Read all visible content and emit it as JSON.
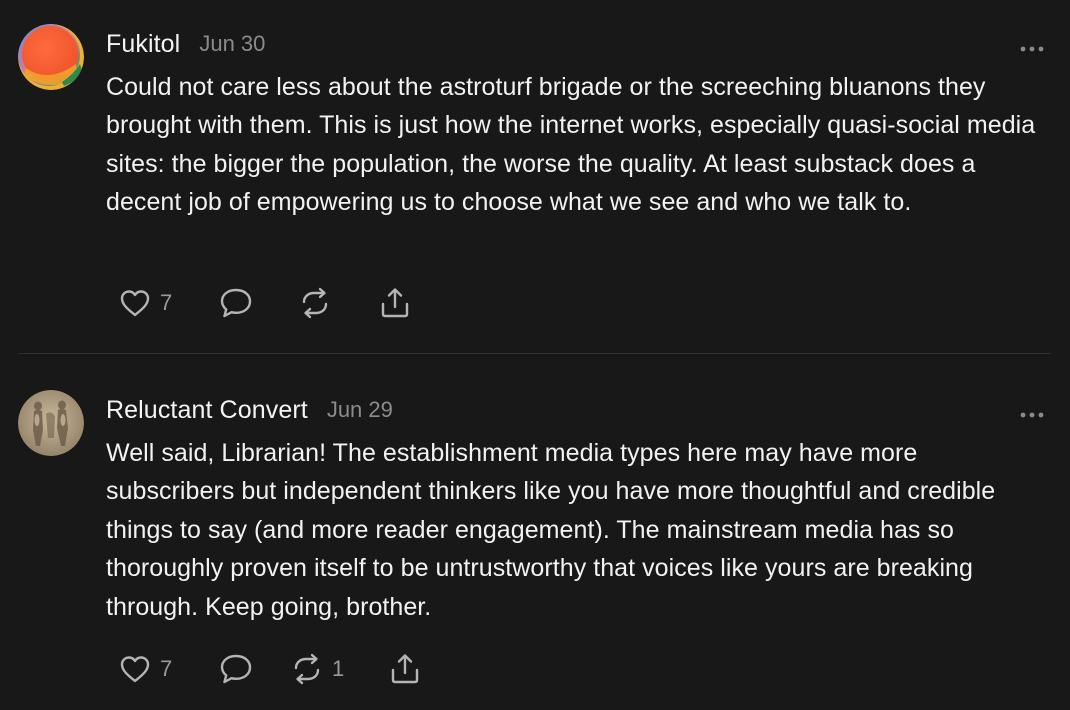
{
  "comments": [
    {
      "author": "Fukitol",
      "date": "Jun 30",
      "avatar_icon": "orange-gradient-avatar",
      "text": "Could not care less about the astroturf brigade or the screeching bluanons they brought with them. This is just how the internet works, especially quasi-social media sites: the bigger the population, the worse the quality. At least substack does a decent job of empowering us to choose what we see and who we talk to.",
      "likes": "7",
      "restacks": ""
    },
    {
      "author": "Reluctant Convert",
      "date": "Jun 29",
      "avatar_icon": "classical-relief-avatar",
      "text": "Well said, Librarian! The establishment media types here may have more subscribers but independent thinkers like you have more thoughtful and credible things to say (and more reader engagement). The mainstream media has so thoroughly proven itself to be untrustworthy that voices like yours are breaking through. Keep going, brother.",
      "likes": "7",
      "restacks": "1"
    }
  ],
  "icons": {
    "like": "heart-icon",
    "reply": "speech-bubble-icon",
    "restack": "restack-icon",
    "share": "share-icon",
    "more": "more-dots-icon"
  },
  "colors": {
    "background": "#181819",
    "text": "#f2f2f2",
    "muted": "#8b8b8e",
    "icon": "#b4b4b6",
    "divider": "#2f2f31"
  }
}
